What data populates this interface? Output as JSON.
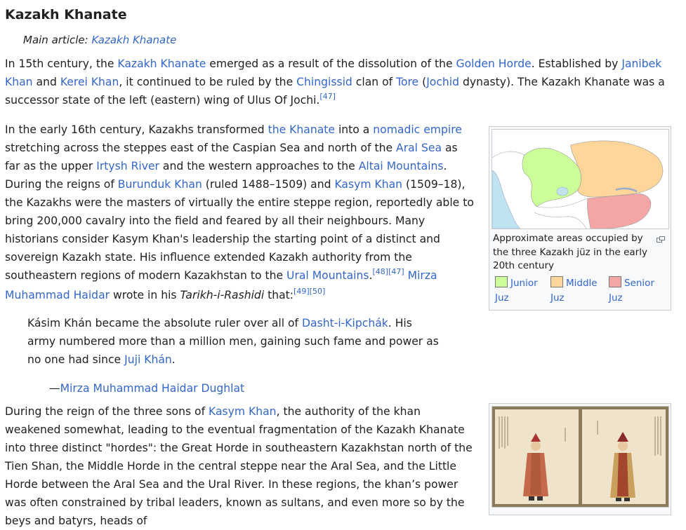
{
  "heading": "Kazakh Khanate",
  "hatnote": {
    "prefix": "Main article: ",
    "link": "Kazakh Khanate"
  },
  "p1": {
    "t1": "In 15th century, the ",
    "l1": "Kazakh Khanate",
    "t2": " emerged as a result of the dissolution of the ",
    "l2": "Golden Horde",
    "t3": ". Established by ",
    "l3": "Janibek Khan",
    "t4": " and ",
    "l4": "Kerei Khan",
    "t5": ", it continued to be ruled by the ",
    "l5": "Chingissid",
    "t6": " clan of ",
    "l6": "Tore",
    "t7": " (",
    "l7": "Jochid",
    "t8": " dynasty). The Kazakh Khanate was a successor state of the left (eastern) wing of Ulus Of Jochi.",
    "ref1": "[47]"
  },
  "p2": {
    "t1": "In the early 16th century, Kazakhs transformed ",
    "l1": "the Khanate",
    "t2": " into a ",
    "l2": "nomadic empire",
    "t3": " stretching across the steppes east of the Caspian Sea and north of the ",
    "l3": "Aral Sea",
    "t4": " as far as the upper ",
    "l4": "Irtysh River",
    "t5": " and the western approaches to the ",
    "l5": "Altai Mountains",
    "t6": ". During the reigns of ",
    "l6": "Burunduk Khan",
    "t7": " (ruled 1488–1509) and ",
    "l7": "Kasym Khan",
    "t8": " (1509–18), the Kazakhs were the masters of virtually the entire steppe region, reportedly able to bring 200,000 cavalry into the field and feared by all their neighbours. Many historians consider Kasym Khan's leadership the starting point of a distinct and sovereign Kazakh state. His influence extended Kazakh authority from the southeastern regions of modern Kazakhstan to the ",
    "l8": "Ural Mountains",
    "t9": ".",
    "ref1": "[48]",
    "ref2": "[47]",
    "t10": " ",
    "l9": "Mirza Muhammad Haidar",
    "t11": " wrote in his ",
    "i1": "Tarikh-i-Rashidi",
    "t12": " that:",
    "ref3": "[49]",
    "ref4": "[50]"
  },
  "quote": {
    "t1": "Kásim Khán became the absolute ruler over all of ",
    "l1": "Dasht-i-Kipchák",
    "t2": ". His army numbered more than a million men, gaining such fame and power as no one had since ",
    "l2": "Juji Khán",
    "t3": "."
  },
  "cite": {
    "dash": "—",
    "link": "Mirza Muhammad Haidar Dughlat"
  },
  "p3": {
    "t1": "During the reign of the three sons of ",
    "l1": "Kasym Khan",
    "t2": ", the authority of the khan weakened somewhat, leading to the eventual fragmentation of the Kazakh Khanate into three distinct \"hordes\": the Great Horde in southeastern Kazakhstan north of the Tien Shan, the Middle Horde in the central steppe near the Aral Sea, and the Little Horde between the Aral Sea and the Ural River. In these regions, the khan’s power was often constrained by tribal leaders, known as sultans, and even more so by the beys and batyrs, heads of"
  },
  "thumb1": {
    "caption": "Approximate areas occupied by the three Kazakh jüz in the early 20th century",
    "legend": [
      {
        "label": "Junior Juz",
        "color": "#ccff99"
      },
      {
        "label": "Middle Juz",
        "color": "#ffd699"
      },
      {
        "label": "Senior Juz",
        "color": "#f4a6a6"
      }
    ]
  },
  "colors": {
    "link": "#3366cc",
    "text": "#202122",
    "thumb_bg": "#f8f9fa",
    "border": "#c8ccd1"
  }
}
